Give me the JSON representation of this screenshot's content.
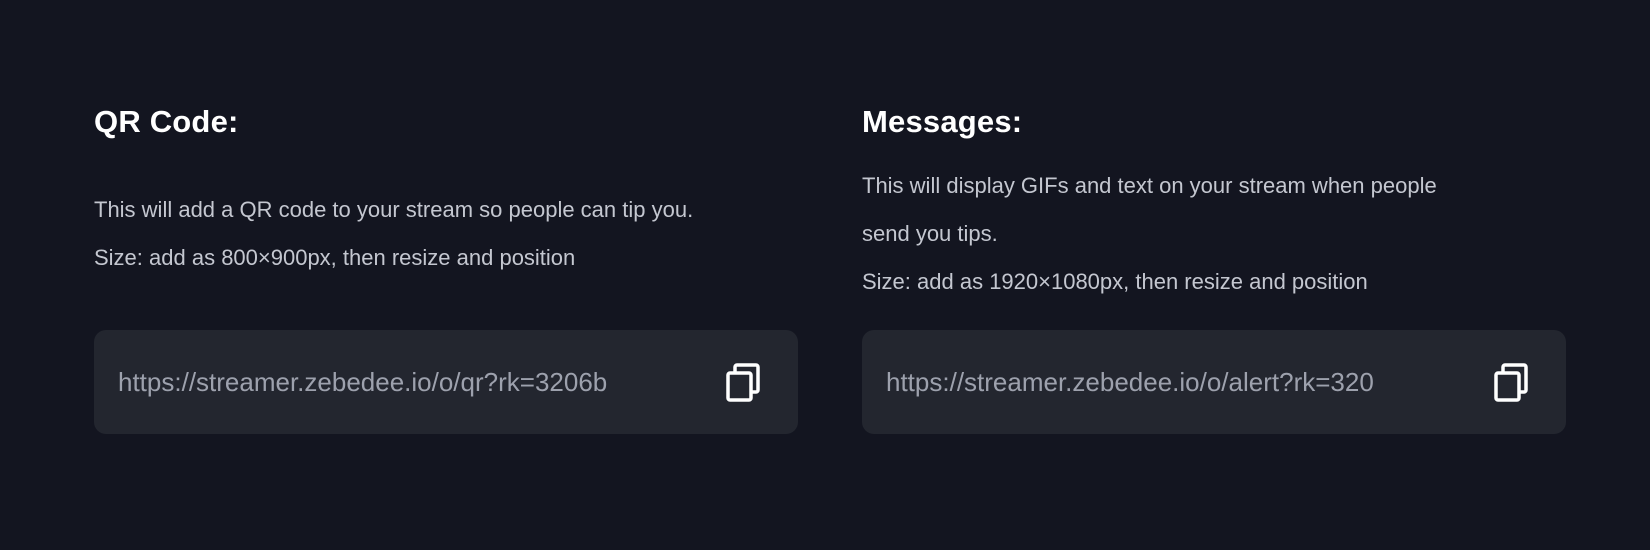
{
  "qr": {
    "title": "QR Code:",
    "description_lines": [
      "This will add a QR code to your stream so people can tip you.",
      "Size: add as 800×900px, then resize and position"
    ],
    "url": "https://streamer.zebedee.io/o/qr?rk=3206b",
    "copy_icon": "copy-icon"
  },
  "messages": {
    "title": "Messages:",
    "description_lines": [
      "This will display GIFs and text on your stream when people",
      "send you tips.",
      "Size: add as 1920×1080px, then resize and position"
    ],
    "url": "https://streamer.zebedee.io/o/alert?rk=320",
    "copy_icon": "copy-icon"
  },
  "colors": {
    "background": "#131520",
    "card": "#23262f",
    "heading": "#ffffff",
    "body_text": "#c4c7d0",
    "url_text": "#9da1ad",
    "icon": "#ffffff"
  }
}
